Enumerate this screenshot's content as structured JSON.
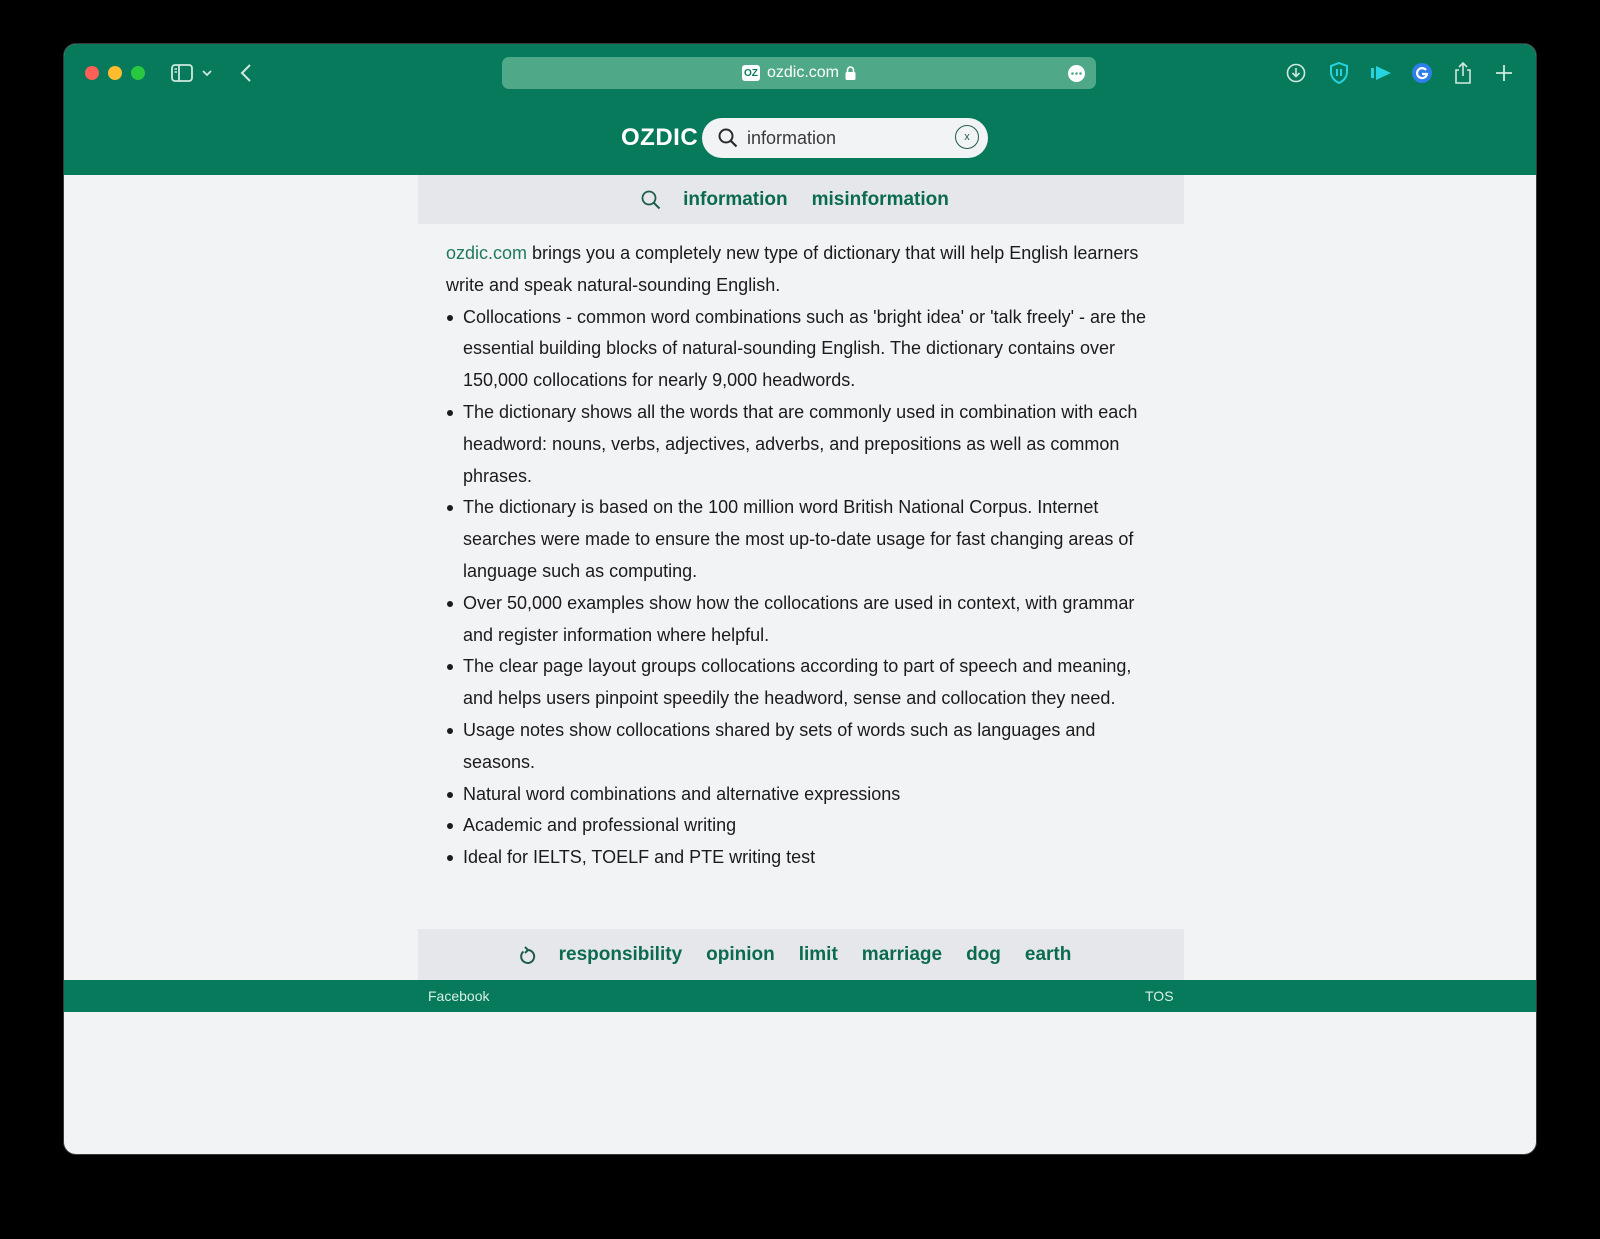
{
  "browser": {
    "url": "ozdic.com",
    "favicon_text": "OZ",
    "colors": {
      "toolbar": "#067a5a",
      "address_bar": "#4fa888",
      "accent_link": "#0b6b4f"
    },
    "toolbar_icons": [
      "sidebar-icon",
      "chevron-down-icon",
      "back-icon",
      "download-icon",
      "shield-extension-icon",
      "media-extension-icon",
      "grammarly-icon",
      "share-icon",
      "new-tab-icon"
    ]
  },
  "header": {
    "brand": "OZDIC",
    "search": {
      "value": "information",
      "clear_label": "x"
    }
  },
  "suggestions": [
    "information",
    "misinformation"
  ],
  "intro": {
    "link": "ozdic.com",
    "text": " brings you a completely new type of dictionary that will help English learners write and speak natural-sounding English."
  },
  "features": [
    "Collocations - common word combinations such as 'bright idea' or 'talk freely' - are the essential building blocks of natural-sounding English. The dictionary contains over 150,000 collocations for nearly 9,000 headwords.",
    "The dictionary shows all the words that are commonly used in combination with each headword: nouns, verbs, adjectives, adverbs, and prepositions as well as common phrases.",
    "The dictionary is based on the 100 million word British National Corpus. Internet searches were made to ensure the most up-to-date usage for fast changing areas of language such as computing.",
    "Over 50,000 examples show how the collocations are used in context, with grammar and register information where helpful.",
    "The clear page layout groups collocations according to part of speech and meaning, and helps users pinpoint speedily the headword, sense and collocation they need.",
    "Usage notes show collocations shared by sets of words such as languages and seasons.",
    "Natural word combinations and alternative expressions",
    "Academic and professional writing",
    "Ideal for IELTS, TOELF and PTE writing test"
  ],
  "history": [
    "responsibility",
    "opinion",
    "limit",
    "marriage",
    "dog",
    "earth"
  ],
  "footer": {
    "left": "Facebook",
    "right": "TOS"
  }
}
